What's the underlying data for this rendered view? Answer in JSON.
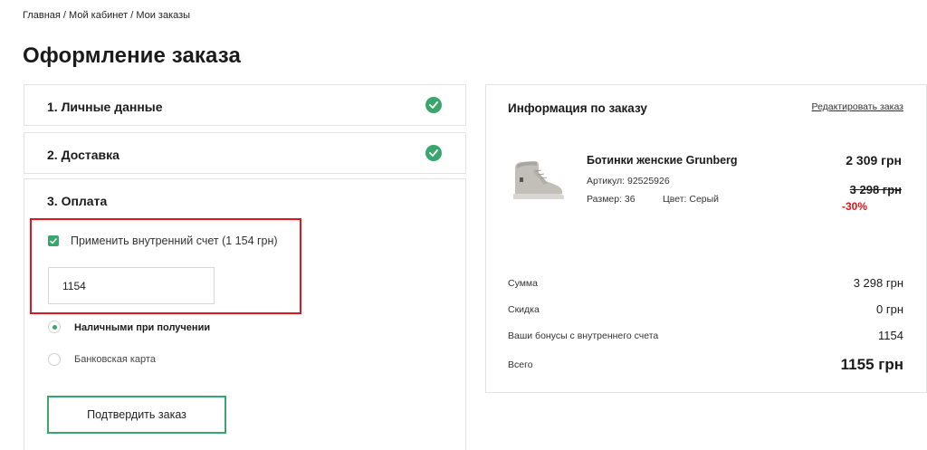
{
  "breadcrumb": {
    "home": "Главная",
    "separator": " / ",
    "cabinet": "Мой кабинет",
    "orders": "Мои заказы"
  },
  "page_title": "Оформление заказа",
  "steps": {
    "personal": {
      "title": "1. Личные данные",
      "completed": true
    },
    "delivery": {
      "title": "2. Доставка",
      "completed": true
    },
    "payment": {
      "title": "3. Оплата"
    }
  },
  "payment": {
    "internal_account_label": "Применить внутренний счет (1 154 грн)",
    "internal_account_checked": true,
    "amount_value": "1154",
    "options": [
      {
        "label": "Наличными при получении",
        "selected": true
      },
      {
        "label": "Банковская карта",
        "selected": false
      }
    ],
    "confirm_label": "Подтвердить заказ"
  },
  "summary": {
    "title": "Информация по заказу",
    "edit_link": "Редактировать заказ",
    "product": {
      "name": "Ботинки женские Grunberg",
      "sku": "Артикул: 92525926",
      "size": "Размер: 36",
      "color": "Цвет: Серый",
      "price_current": "2 309 грн",
      "price_old": "3 298 грн",
      "discount": "-30%"
    },
    "rows": {
      "sum": {
        "label": "Сумма",
        "value": "3 298 грн"
      },
      "discount": {
        "label": "Скидка",
        "value": "0 грн"
      },
      "bonuses": {
        "label": "Ваши бонусы с внутреннего счета",
        "value": "1154"
      },
      "total": {
        "label": "Всего",
        "value": "1155 грн"
      }
    }
  },
  "colors": {
    "accent_green": "#3aa66d",
    "highlight_red": "#e0161c",
    "discount_red": "#e0161c"
  },
  "icons": {
    "step_complete": "check-circle-icon",
    "checkbox": "checkbox-checked-icon",
    "product": "boot-product-image"
  }
}
